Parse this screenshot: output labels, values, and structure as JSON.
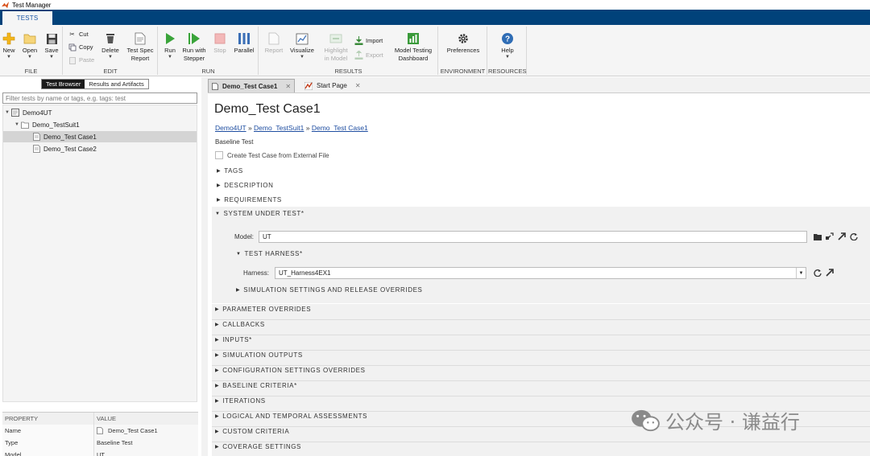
{
  "window": {
    "title": "Test Manager"
  },
  "ribbon": {
    "tab": "TESTS",
    "groups": {
      "file": "FILE",
      "edit": "EDIT",
      "run": "RUN",
      "results": "RESULTS",
      "environment": "ENVIRONMENT",
      "resources": "RESOURCES"
    },
    "buttons": {
      "new": "New",
      "open": "Open",
      "save": "Save",
      "cut": "Cut",
      "copy": "Copy",
      "paste": "Paste",
      "delete": "Delete",
      "test_spec_1": "Test Spec",
      "test_spec_2": "Report",
      "run": "Run",
      "run_with_1": "Run with",
      "run_with_2": "Stepper",
      "stop": "Stop",
      "parallel": "Parallel",
      "report": "Report",
      "visualize": "Visualize",
      "highlight_1": "Highlight",
      "highlight_2": "in Model",
      "import": "Import",
      "export": "Export",
      "mtd_1": "Model Testing",
      "mtd_2": "Dashboard",
      "preferences": "Preferences",
      "help": "Help"
    }
  },
  "browser": {
    "tabs": [
      "Test Browser",
      "Results and Artifacts"
    ],
    "filter_placeholder": "Filter tests by name or tags, e.g. tags: test",
    "tree": [
      "Demo4UT",
      "Demo_TestSuit1",
      "Demo_Test Case1",
      "Demo_Test Case2"
    ]
  },
  "properties": {
    "header": [
      "PROPERTY",
      "VALUE"
    ],
    "rows": [
      [
        "Name",
        "Demo_Test Case1"
      ],
      [
        "Type",
        "Baseline Test"
      ],
      [
        "Model",
        "UT"
      ]
    ]
  },
  "doc_tabs": [
    "Demo_Test Case1",
    "Start Page"
  ],
  "main": {
    "title": "Demo_Test Case1",
    "crumbs": [
      "Demo4UT",
      "Demo_TestSuit1",
      "Demo_Test Case1"
    ],
    "crumb_sep": " » ",
    "type": "Baseline Test",
    "checkbox": "Create Test Case from External File",
    "sections_top": [
      "TAGS",
      "DESCRIPTION",
      "REQUIREMENTS"
    ],
    "sut": "SYSTEM UNDER TEST*",
    "model_label": "Model:",
    "model_value": "UT",
    "harness_section": "TEST HARNESS*",
    "harness_label": "Harness:",
    "harness_value": "UT_Harness4EX1",
    "sim_settings": "SIMULATION SETTINGS AND RELEASE OVERRIDES",
    "sections_bottom": [
      "PARAMETER OVERRIDES",
      "CALLBACKS",
      "INPUTS*",
      "SIMULATION OUTPUTS",
      "CONFIGURATION SETTINGS OVERRIDES",
      "BASELINE CRITERIA*",
      "ITERATIONS",
      "LOGICAL AND TEMPORAL ASSESSMENTS",
      "CUSTOM CRITERIA",
      "COVERAGE SETTINGS"
    ]
  },
  "watermark": "公众号 · 谦益行"
}
